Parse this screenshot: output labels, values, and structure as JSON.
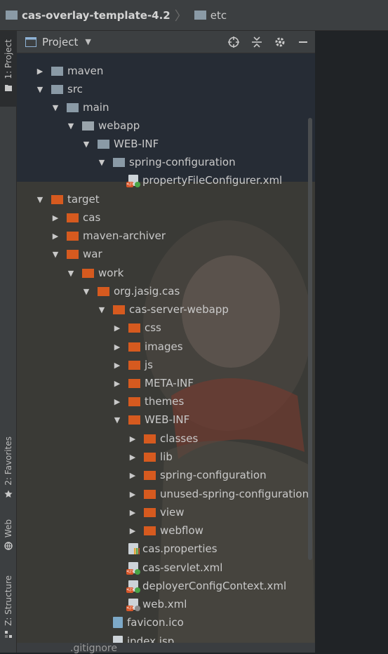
{
  "breadcrumb": {
    "root": "cas-overlay-template-4.2",
    "child": "etc"
  },
  "stripe": {
    "project": "1: Project",
    "favorites": "2: Favorites",
    "web": "Web",
    "structure": "Z: Structure"
  },
  "panel": {
    "title": "Project"
  },
  "tree": [
    {
      "label": "maven",
      "icon": "folder-grey",
      "arrow": "collapsed"
    },
    {
      "label": "src",
      "icon": "folder-grey",
      "arrow": "expanded"
    },
    {
      "label": "main",
      "icon": "folder-grey",
      "arrow": "expanded"
    },
    {
      "label": "webapp",
      "icon": "webapp-folder",
      "arrow": "expanded"
    },
    {
      "label": "WEB-INF",
      "icon": "folder-grey",
      "arrow": "expanded"
    },
    {
      "label": "spring-configuration",
      "icon": "folder-grey",
      "arrow": "expanded"
    },
    {
      "label": "propertyFileConfigurer.xml",
      "icon": "xml-file",
      "arrow": "none"
    },
    {
      "label": "target",
      "icon": "folder-orange",
      "arrow": "expanded"
    },
    {
      "label": "cas",
      "icon": "folder-orange",
      "arrow": "collapsed"
    },
    {
      "label": "maven-archiver",
      "icon": "folder-orange",
      "arrow": "collapsed"
    },
    {
      "label": "war",
      "icon": "folder-orange",
      "arrow": "expanded"
    },
    {
      "label": "work",
      "icon": "folder-orange",
      "arrow": "expanded"
    },
    {
      "label": "org.jasig.cas",
      "icon": "folder-orange",
      "arrow": "expanded"
    },
    {
      "label": "cas-server-webapp",
      "icon": "folder-orange",
      "arrow": "expanded"
    },
    {
      "label": "css",
      "icon": "folder-orange",
      "arrow": "collapsed"
    },
    {
      "label": "images",
      "icon": "folder-orange",
      "arrow": "collapsed"
    },
    {
      "label": "js",
      "icon": "folder-orange",
      "arrow": "collapsed"
    },
    {
      "label": "META-INF",
      "icon": "folder-orange",
      "arrow": "collapsed"
    },
    {
      "label": "themes",
      "icon": "folder-orange",
      "arrow": "collapsed"
    },
    {
      "label": "WEB-INF",
      "icon": "folder-orange",
      "arrow": "expanded"
    },
    {
      "label": "classes",
      "icon": "folder-orange",
      "arrow": "collapsed"
    },
    {
      "label": "lib",
      "icon": "folder-orange",
      "arrow": "collapsed"
    },
    {
      "label": "spring-configuration",
      "icon": "folder-orange",
      "arrow": "collapsed"
    },
    {
      "label": "unused-spring-configuration",
      "icon": "folder-orange",
      "arrow": "collapsed"
    },
    {
      "label": "view",
      "icon": "folder-orange",
      "arrow": "collapsed"
    },
    {
      "label": "webflow",
      "icon": "folder-orange",
      "arrow": "collapsed"
    },
    {
      "label": "cas.properties",
      "icon": "properties-file",
      "arrow": "none"
    },
    {
      "label": "cas-servlet.xml",
      "icon": "xml-file",
      "arrow": "none"
    },
    {
      "label": "deployerConfigContext.xml",
      "icon": "xml-file",
      "arrow": "none"
    },
    {
      "label": "web.xml",
      "icon": "web-xml-file",
      "arrow": "none"
    },
    {
      "label": "favicon.ico",
      "icon": "ico-file",
      "arrow": "none"
    },
    {
      "label": "index.jsp",
      "icon": "jsp-file",
      "arrow": "none"
    }
  ],
  "bottom": {
    "partial_label": ".gitignore"
  },
  "colors": {
    "excluded_folder": "#d65a1f",
    "source_folder": "#8a9aa6",
    "panel_bg": "#2b2d30"
  }
}
